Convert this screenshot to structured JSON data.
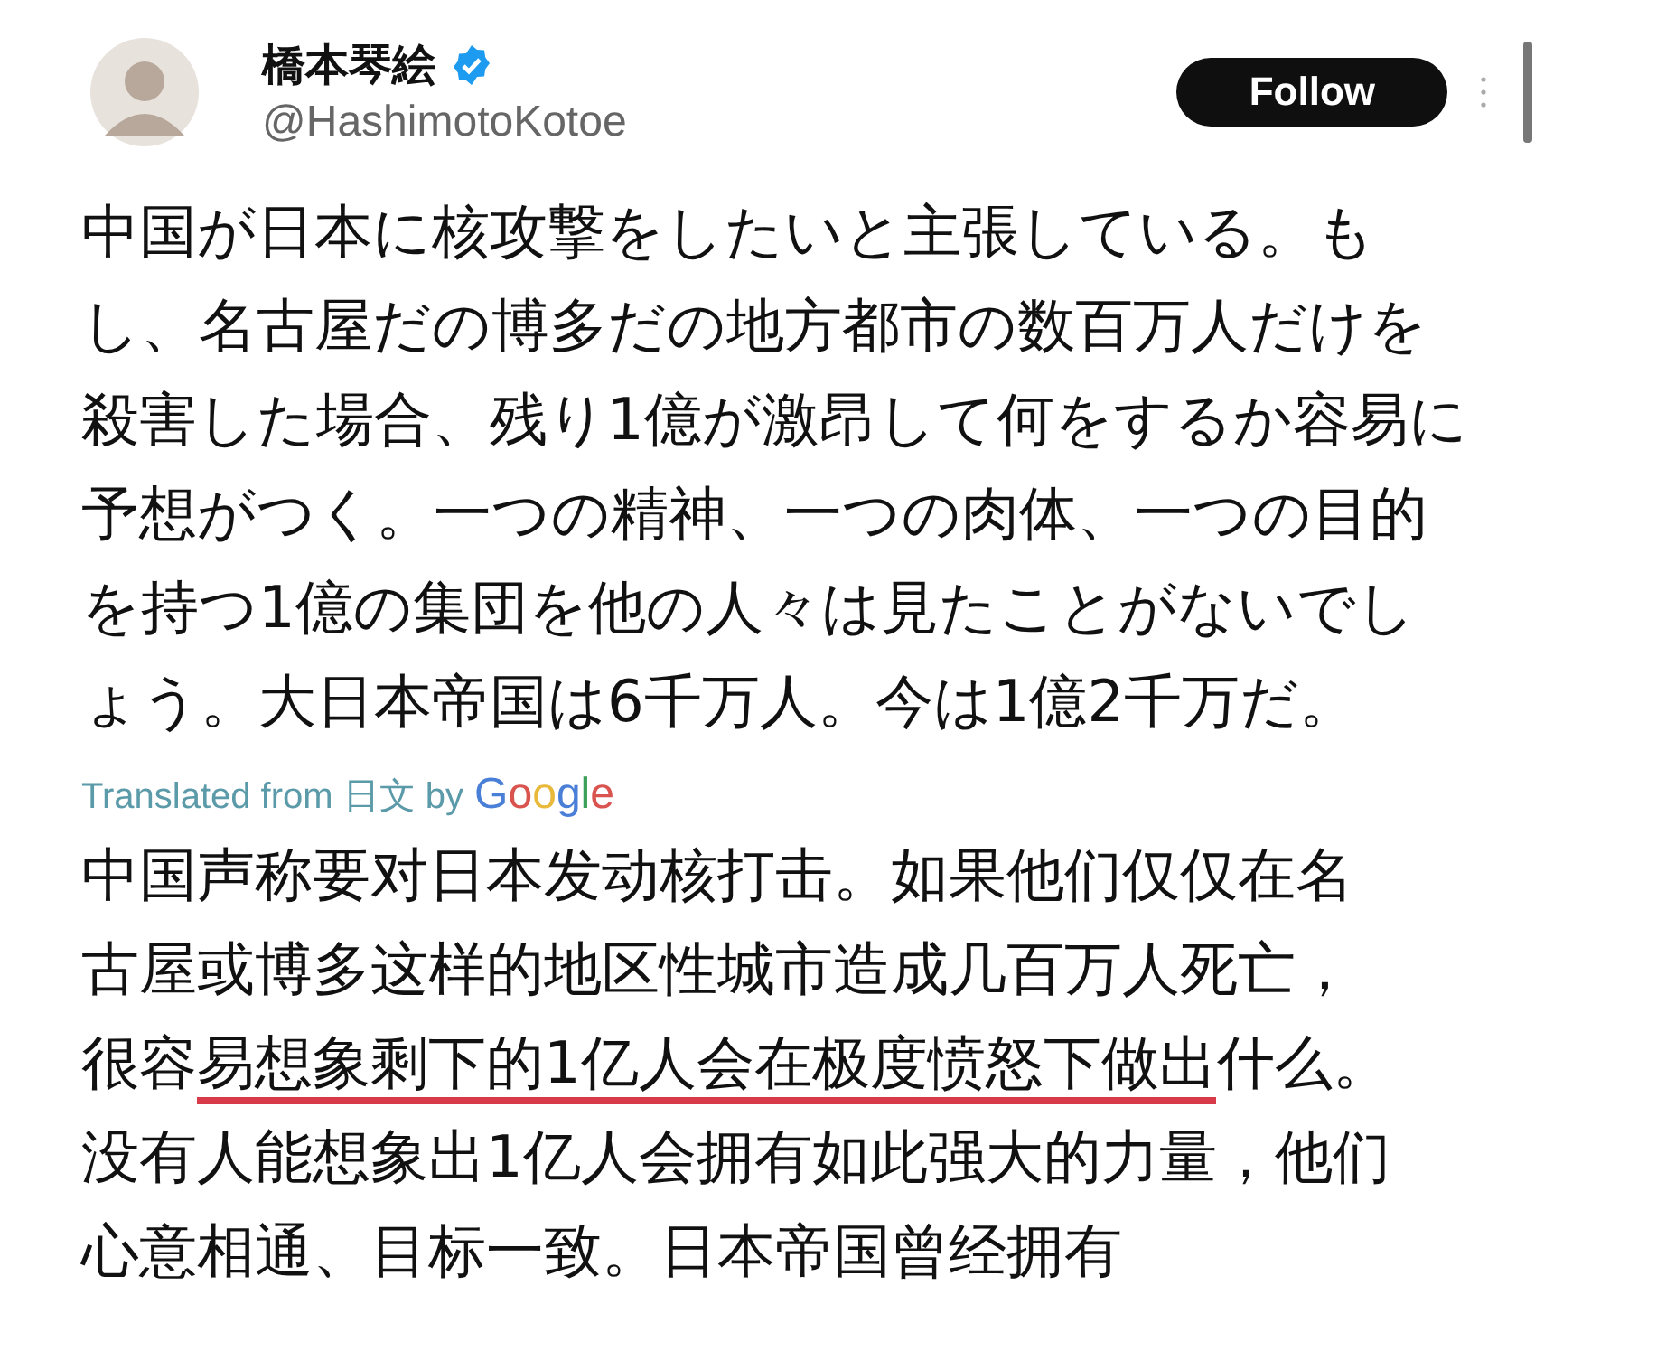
{
  "author": {
    "name": "橋本琴絵",
    "verified": true,
    "handle": "@HashimotoKotoe"
  },
  "follow_button": "Follow",
  "body": "中国が日本に核攻撃をしたいと主張している。もし、名古屋だの博多だの地方都市の数百万人だけを殺害した場合、残り1億が激昂して何をするか容易に予想がつく。一つの精神、一つの肉体、一つの目的を持つ1億の集団を他の人々は見たことがないでしょう。大日本帝国は6千万人。今は1億2千万だ。",
  "translation_note": {
    "prefix": "Translated from 日文 by",
    "brand": "Google"
  },
  "translation": {
    "before": "中国声称要对日本发动核打击。如果他们仅仅在名古屋或博多这样的地区性城市造成几百万人死亡，很容",
    "underlined": "易想象剩下的1亿人会在极度愤怒下做出",
    "after": "什么。没有人能想象出1亿人会拥有如此强大的力量，他们心意相通、目标一致。日本帝国曾经拥有"
  }
}
